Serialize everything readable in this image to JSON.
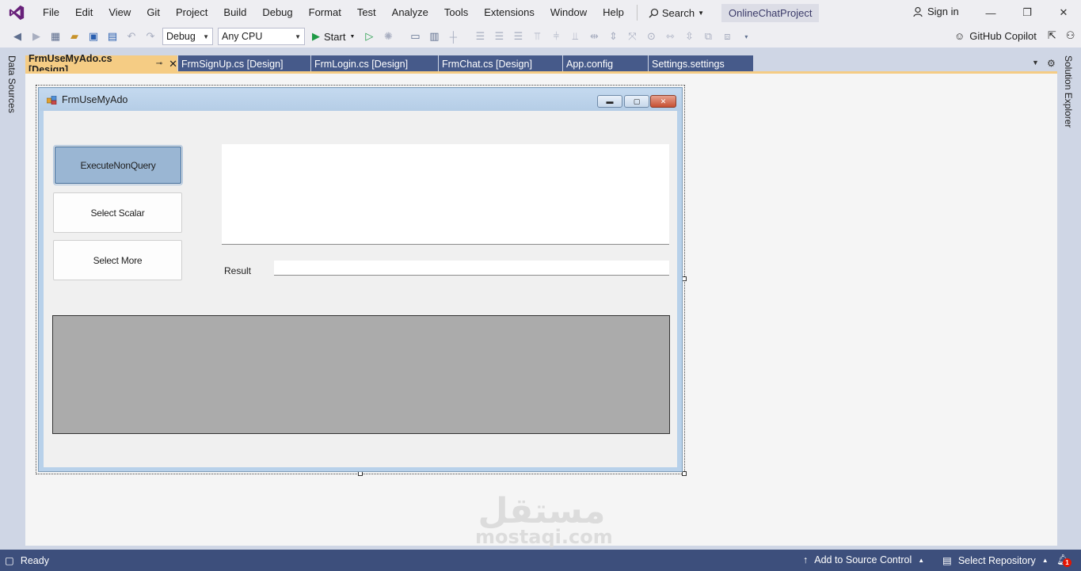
{
  "menubar": {
    "items": [
      "File",
      "Edit",
      "View",
      "Git",
      "Project",
      "Build",
      "Debug",
      "Format",
      "Test",
      "Analyze",
      "Tools",
      "Extensions",
      "Window",
      "Help"
    ],
    "search_label": "Search",
    "project_name": "OnlineChatProject",
    "signin_label": "Sign in"
  },
  "toolbar": {
    "config_value": "Debug",
    "platform_value": "Any CPU",
    "start_label": "Start",
    "copilot_label": "GitHub Copilot"
  },
  "side_tabs": {
    "left": "Data Sources",
    "right": "Solution Explorer"
  },
  "doc_tabs": [
    {
      "label": "FrmUseMyAdo.cs [Design]",
      "active": true
    },
    {
      "label": "FrmSignUp.cs [Design]",
      "active": false
    },
    {
      "label": "FrmLogin.cs [Design]",
      "active": false
    },
    {
      "label": "FrmChat.cs [Design]",
      "active": false
    },
    {
      "label": "App.config",
      "active": false
    },
    {
      "label": "Settings.settings",
      "active": false
    }
  ],
  "form": {
    "title": "FrmUseMyAdo",
    "buttons": [
      "ExecuteNonQuery",
      "Select Scalar",
      "Select More"
    ],
    "result_label": "Result",
    "multiline_text": "",
    "result_text": ""
  },
  "watermark": {
    "arabic": "مستقل",
    "latin": "mostaqi.com"
  },
  "statusbar": {
    "ready": "Ready",
    "source_control": "Add to Source Control",
    "repository": "Select Repository",
    "notifications_count": "1"
  },
  "colors": {
    "accent_tab": "#f5cc84",
    "status_bar": "#3d4f7c",
    "inactive_tab": "#465a8a",
    "vs_purple": "#68217a"
  }
}
